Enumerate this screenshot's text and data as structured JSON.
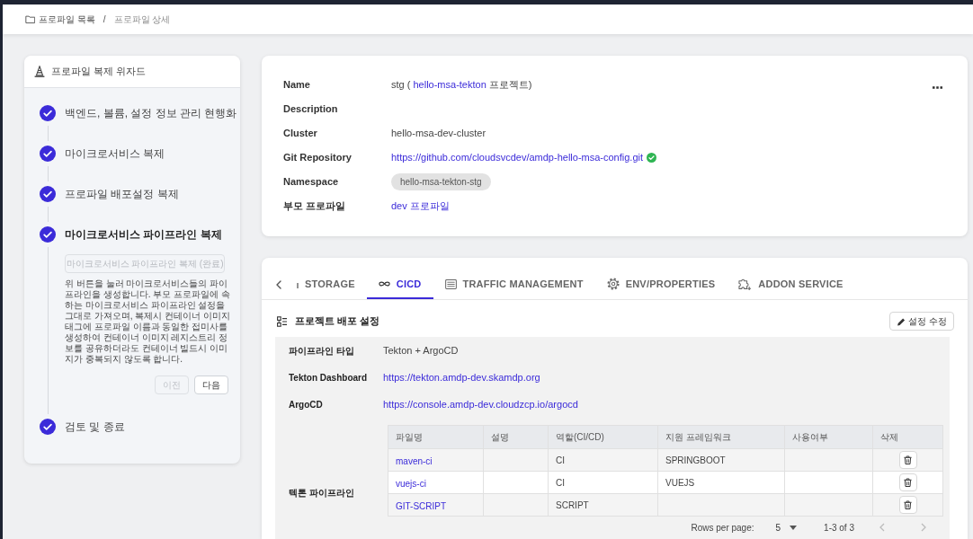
{
  "breadcrumb": {
    "items": [
      {
        "label": "프로파일 목록"
      },
      {
        "label": "프로파일 상세"
      }
    ],
    "separator": "/"
  },
  "wizard": {
    "title": "프로파일 복제 위자드",
    "steps": [
      {
        "label": "백엔드, 볼륨, 설정 정보 관리 현행화",
        "completed": true,
        "selected": false
      },
      {
        "label": "마이크로서비스 복제",
        "completed": true,
        "selected": false
      },
      {
        "label": "프로파일 배포설정 복제",
        "completed": true,
        "selected": false
      },
      {
        "label": "마이크로서비스 파이프라인 복제",
        "completed": true,
        "selected": true,
        "detail": {
          "action": {
            "label": "마이크로서비스 파이프라인 복제 (완료)",
            "disabled": true
          },
          "description": "위 버튼을 눌러 마이크로서비스들의 파이프라인을 생성합니다. 부모 프로파일에 속하는 마이크로서비스 파이프라인 설정을 그대로 가져오며, 복제시 컨테이너 이미지 태그에 프로파일 이름과 동일한 접미사를 생성하여 컨테이너 이미지 레지스트리 정보를 공유하더라도 컨테이너 빌드시 이미지가 중복되지 않도록 합니다.",
          "buttons": [
            {
              "label": "이전",
              "disabled": true
            },
            {
              "label": "다음",
              "disabled": false
            }
          ]
        }
      },
      {
        "label": "검토 및 종료",
        "completed": true,
        "selected": false
      }
    ]
  },
  "profile": {
    "fields": [
      {
        "label": "Name",
        "kind": "name",
        "text_before": "stg ( ",
        "project": "hello-msa-tekton",
        "text_after": " 프로젝트)"
      },
      {
        "label": "Description"
      },
      {
        "label": "Cluster",
        "kind": "text",
        "value": "hello-msa-dev-cluster"
      },
      {
        "label": "Git Repository",
        "kind": "link",
        "value": "https://github.com/cloudsvcdev/amdp-hello-msa-config.git",
        "verified": true
      },
      {
        "label": "Namespace",
        "kind": "badge",
        "value": "hello-msa-tekton-stg"
      },
      {
        "label": "부모 프로파일",
        "kind": "link",
        "value": "dev 프로파일"
      }
    ]
  },
  "tabs": {
    "items": [
      {
        "label": "STORAGE",
        "kind": "storage",
        "selected": false
      },
      {
        "label": "CICD",
        "kind": "cicd",
        "selected": true
      },
      {
        "label": "TRAFFIC MANAGEMENT",
        "kind": "traffic",
        "selected": false
      },
      {
        "label": "ENV/PROPERTIES",
        "kind": "env",
        "selected": false
      },
      {
        "label": "ADDON SERVICE",
        "kind": "addon",
        "selected": false
      }
    ]
  },
  "deploy_settings": {
    "title": "프로젝트 배포 설정",
    "edit_button": "설정 수정",
    "rows": [
      {
        "label": "파이프라인 타입",
        "kind": "text",
        "value": "Tekton + ArgoCD"
      },
      {
        "label": "Tekton Dashboard",
        "kind": "link",
        "value": "https://tekton.amdp-dev.skamdp.org"
      },
      {
        "label": "ArgoCD",
        "kind": "link",
        "value": "https://console.amdp-dev.cloudzcp.io/argocd"
      },
      {
        "label": "텍톤 파이프라인",
        "kind": "table"
      }
    ],
    "pipeline_table": {
      "columns": [
        "파일명",
        "설명",
        "역할(CI/CD)",
        "지원 프레임워크",
        "사용여부",
        "삭제"
      ],
      "rows": [
        {
          "file_name": "maven-ci",
          "role": "CI",
          "framework": "SPRINGBOOT"
        },
        {
          "file_name": "vuejs-ci",
          "role": "CI",
          "framework": "VUEJS"
        },
        {
          "file_name": "GIT-SCRIPT",
          "role": "SCRIPT"
        }
      ]
    },
    "pagination": {
      "rows_per_page_label": "Rows per page:",
      "rows_per_page": "5",
      "range": "1-3 of 3"
    }
  }
}
